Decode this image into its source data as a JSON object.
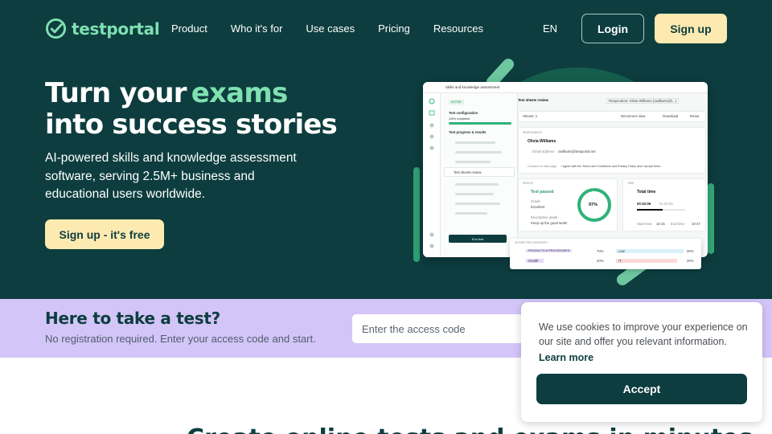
{
  "brand": {
    "name": "testportal",
    "accent_color": "#7fe0b0",
    "dark_color": "#0d3d3f",
    "cta_color": "#fdeab0"
  },
  "nav": {
    "links": [
      "Product",
      "Who it's for",
      "Use cases",
      "Pricing",
      "Resources"
    ],
    "language": "EN",
    "login_label": "Login",
    "signup_label": "Sign up"
  },
  "hero": {
    "headline_part1": "Turn your",
    "headline_accent": "exams",
    "headline_line2": "into success stories",
    "subtext": "AI-powered skills and knowledge assessment software, serving 2.5M+ business and educational users worldwide.",
    "cta_label": "Sign up - it's free"
  },
  "mockup": {
    "window_title": "Skills and knowledge assessment",
    "panel_badge": "ACTIVE",
    "test_config": "Test configuration",
    "completed": "100% completed",
    "progress_title": "Test progress & results",
    "sheet_item": "Test sheets review",
    "end_test": "End test",
    "main_title": "Test sheets review",
    "respondent": "Respondent: Olivia Williams (owilliams@t...)",
    "sheets": "Sheets: 1",
    "reconnect": "Reconnect view",
    "download": "Download",
    "reset": "Reset",
    "section_label": "RESPONDENT",
    "respondent_name": "Olivia Williams",
    "email_label": "Email address",
    "email": "owilliams@testportal.net",
    "consent": "Consent on start page",
    "consent_text": "I agree with the Terms and Conditions and Privacy Policy and I accept them.",
    "result_label": "RESULT",
    "result": "Test passed",
    "grade_label": "Grade",
    "grade": "Excellent",
    "desc_label": "Descriptive grade",
    "desc": "Keep up the good work!",
    "score_percent": 97,
    "time_label": "TIME",
    "total_time": "Total time",
    "time_used": "00:32:05",
    "time_limit": "01:00:00",
    "start_label": "Start time",
    "start": "10:15",
    "end_label": "End time",
    "end": "10:47",
    "category_label": "SCORE PER CATEGORY",
    "categories": [
      {
        "name": "PRODUCTS & PROCEDURES",
        "value": "70%",
        "name2": "Law",
        "value2": "20%"
      },
      {
        "name": "Health",
        "value": "20%",
        "name2": "IT",
        "value2": "20%"
      }
    ]
  },
  "test_strip": {
    "title": "Here to take a test?",
    "subtitle": "No registration required. Enter your access code and start.",
    "access_placeholder": "Enter the access code"
  },
  "below": {
    "heading": "Create online tests and exams in minutes"
  },
  "cookie": {
    "text": "We use cookies to improve your experience on our site and offer you relevant information.",
    "learn_more": "Learn more",
    "accept_label": "Accept"
  }
}
